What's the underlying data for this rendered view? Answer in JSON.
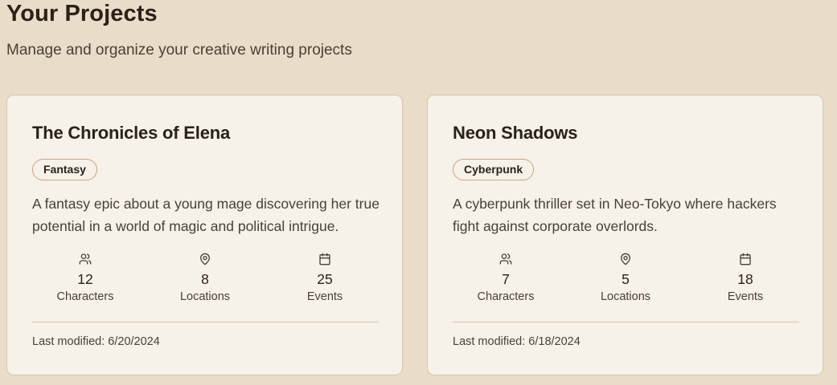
{
  "header": {
    "title": "Your Projects",
    "subtitle": "Manage and organize your creative writing projects"
  },
  "colors": {
    "background": "#e9dcc9",
    "card_background": "#f6f1e9",
    "card_border": "#d9c6a8",
    "badge_border": "#c8a57f",
    "text_primary": "#2b2118",
    "text_secondary": "#4a3f35"
  },
  "projects": [
    {
      "title": "The Chronicles of Elena",
      "genre": "Fantasy",
      "description": "A fantasy epic about a young mage discovering her true potential in a world of magic and political intrigue.",
      "stats": [
        {
          "icon": "users-icon",
          "value": "12",
          "label": "Characters"
        },
        {
          "icon": "map-pin-icon",
          "value": "8",
          "label": "Locations"
        },
        {
          "icon": "calendar-icon",
          "value": "25",
          "label": "Events"
        }
      ],
      "last_modified": "Last modified: 6/20/2024"
    },
    {
      "title": "Neon Shadows",
      "genre": "Cyberpunk",
      "description": "A cyberpunk thriller set in Neo-Tokyo where hackers fight against corporate overlords.",
      "stats": [
        {
          "icon": "users-icon",
          "value": "7",
          "label": "Characters"
        },
        {
          "icon": "map-pin-icon",
          "value": "5",
          "label": "Locations"
        },
        {
          "icon": "calendar-icon",
          "value": "18",
          "label": "Events"
        }
      ],
      "last_modified": "Last modified: 6/18/2024"
    }
  ]
}
